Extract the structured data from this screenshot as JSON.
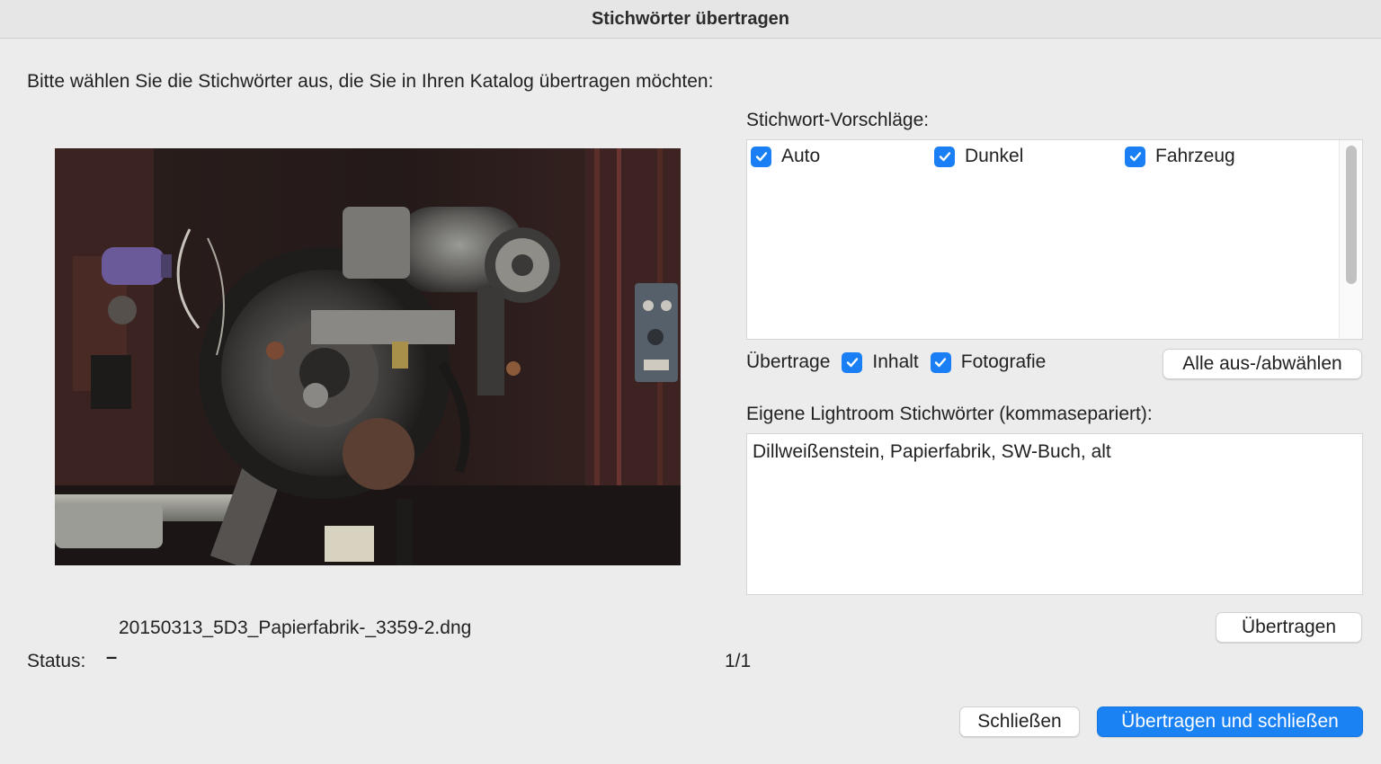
{
  "window": {
    "title": "Stichwörter übertragen"
  },
  "intro_text": "Bitte wählen Sie die Stichwörter aus, die Sie in Ihren Katalog übertragen möchten:",
  "photo": {
    "filename": "20150313_5D3_Papierfabrik-_3359-2.dng"
  },
  "status": {
    "label": "Status:",
    "value": "–"
  },
  "counter": "1/1",
  "suggestions": {
    "label": "Stichwort-Vorschläge:",
    "items": [
      {
        "label": "Auto",
        "checked": true
      },
      {
        "label": "Dunkel",
        "checked": true
      },
      {
        "label": "Fahrzeug",
        "checked": true
      }
    ]
  },
  "transfer_options": {
    "label": "Übertrage",
    "content": {
      "label": "Inhalt",
      "checked": true
    },
    "photography": {
      "label": "Fotografie",
      "checked": true
    },
    "toggle_all_label": "Alle aus-/abwählen"
  },
  "own_keywords": {
    "label": "Eigene Lightroom Stichwörter (kommasepariert):",
    "value": "Dillweißenstein, Papierfabrik, SW-Buch, alt"
  },
  "buttons": {
    "transfer": "Übertragen",
    "close": "Schließen",
    "transfer_and_close": "Übertragen und schließen"
  },
  "colors": {
    "accent": "#1b82f3",
    "checkbox": "#1a7ff5",
    "background": "#ececec"
  }
}
